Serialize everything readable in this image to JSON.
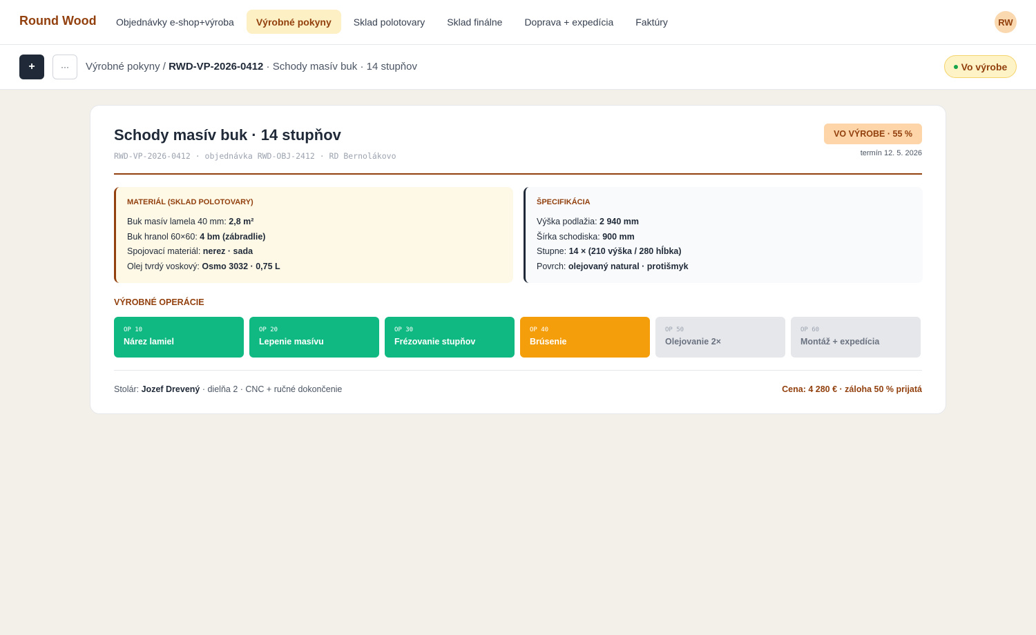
{
  "app": {
    "brand": "Round Wood",
    "user_initials": "RW"
  },
  "nav": {
    "tabs": [
      {
        "label": "Objednávky e-shop+výroba"
      },
      {
        "label": "Výrobné pokyny",
        "active": true
      },
      {
        "label": "Sklad polotovary"
      },
      {
        "label": "Sklad finálne"
      },
      {
        "label": "Doprava + expedícia"
      },
      {
        "label": "Faktúry"
      }
    ]
  },
  "toolbar": {
    "add_label": "+",
    "more_label": "···"
  },
  "breadcrumb": {
    "section": "Výrobné pokyny",
    "separator": " / ",
    "code": "RWD-VP-2026-0412",
    "suffix": " · Schody masív buk · 14 stupňov"
  },
  "status": {
    "label": "Vo výrobe",
    "dot_color": "#16a34a"
  },
  "order": {
    "title": "Schody masív buk · 14 stupňov",
    "meta": "RWD-VP-2026-0412 · objednávka RWD-OBJ-2412 · RD Bernolákovo",
    "progress_badge": "VO VÝROBE · 55 %",
    "progress_percent": 55,
    "deadline": "termín 12. 5. 2026"
  },
  "material": {
    "heading": "MATERIÁL (SKLAD POLOTOVARY)",
    "rows": [
      {
        "label": "Buk masív lamela 40 mm: ",
        "value": "2,8 m²"
      },
      {
        "label": "Buk hranol 60×60: ",
        "value": "4 bm (zábradlie)"
      },
      {
        "label": "Spojovací materiál: ",
        "value": "nerez · sada"
      },
      {
        "label": "Olej tvrdý voskový: ",
        "value": "Osmo 3032 · 0,75 L"
      }
    ]
  },
  "specification": {
    "heading": "ŠPECIFIKÁCIA",
    "rows": [
      {
        "label": "Výška podlažia: ",
        "value": "2 940 mm"
      },
      {
        "label": "Šírka schodiska: ",
        "value": "900 mm"
      },
      {
        "label": "Stupne: ",
        "value": "14 × (210 výška / 280 hĺbka)"
      },
      {
        "label": "Povrch: ",
        "value": "olejovaný natural · protišmyk"
      }
    ]
  },
  "operations": {
    "heading": "VÝROBNÉ OPERÁCIE",
    "items": [
      {
        "code": "OP 10",
        "name": "Nárez lamiel",
        "state": "done"
      },
      {
        "code": "OP 20",
        "name": "Lepenie masívu",
        "state": "done"
      },
      {
        "code": "OP 30",
        "name": "Frézovanie stupňov",
        "state": "done"
      },
      {
        "code": "OP 40",
        "name": "Brúsenie",
        "state": "active"
      },
      {
        "code": "OP 50",
        "name": "Olejovanie 2×",
        "state": "todo"
      },
      {
        "code": "OP 60",
        "name": "Montáž + expedícia",
        "state": "todo"
      }
    ]
  },
  "footer": {
    "carpenter_label": "Stolár: ",
    "carpenter_name": "Jozef Drevený",
    "carpenter_details": " · dielňa 2 · CNC + ručné dokončenie",
    "price": "Cena: 4 280 € · záloha 50 % prijatá"
  },
  "colors": {
    "brand": "#92400e",
    "op_done": "#10b981",
    "op_active": "#f59e0b",
    "op_todo": "#e5e7eb"
  }
}
